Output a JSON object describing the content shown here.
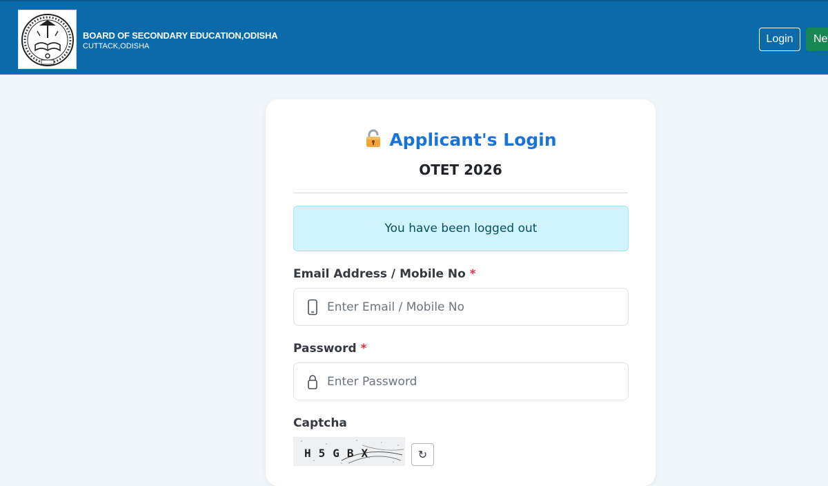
{
  "header": {
    "org_name": "BOARD OF SECONDARY EDUCATION,ODISHA",
    "org_location": "CUTTACK,ODISHA",
    "login_label": "Login",
    "new_label": "New",
    "bg_color": "#0b6aaa"
  },
  "card": {
    "title_icon": "lock-icon",
    "title": "Applicant's Login",
    "subtitle": "OTET 2026",
    "alert": "You have been logged out"
  },
  "form": {
    "email_label": "Email Address / Mobile No",
    "email_placeholder": "Enter Email / Mobile No",
    "email_value": "",
    "password_label": "Password",
    "password_placeholder": "Enter Password",
    "password_value": "",
    "required_mark": "*",
    "captcha_label": "Captcha",
    "captcha_text": "H5GBX",
    "refresh_symbol": "↻"
  }
}
